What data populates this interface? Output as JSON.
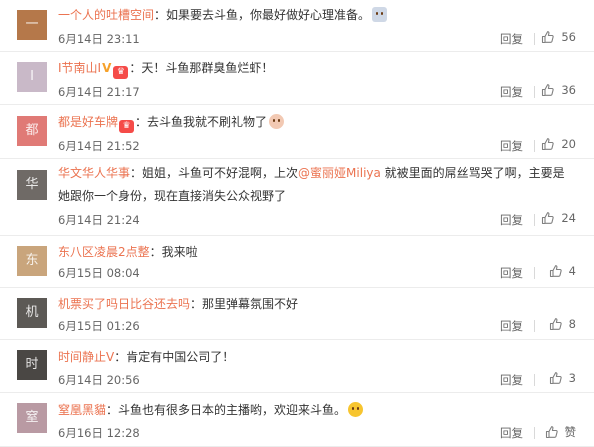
{
  "ui": {
    "reply_label": "回复"
  },
  "comments": [
    {
      "username": "一个人的吐槽空间",
      "text": "如果要去斗鱼，你最好做好心理准备。",
      "emoji": "person-emoji",
      "time": "6月14日 23:11",
      "likes": "56",
      "avatar_color": "#b5784a",
      "avatar_initial": "一"
    },
    {
      "username": "I节南山I",
      "badges": [
        "verified-v",
        "vip"
      ],
      "text": "天！斗鱼那群臭鱼烂虾！",
      "time": "6月14日 21:17",
      "likes": "36",
      "avatar_color": "#c9b9c8",
      "avatar_initial": "I"
    },
    {
      "username": "都是好车牌",
      "badges": [
        "vip"
      ],
      "text": "去斗鱼我就不刷礼物了",
      "emoji": "rabbit-emoji",
      "time": "6月14日 21:52",
      "likes": "20",
      "avatar_color": "#e07a76",
      "avatar_initial": "都"
    },
    {
      "username": "华文华人华事",
      "text_before": "姐姐，斗鱼可不好混啊，上次",
      "mention": "@蜜丽娅Miliya",
      "text_after": " 就被里面的屌丝骂哭了啊，主要是她跟你一个身份，现在直接消失公众视野了",
      "time": "6月14日 21:24",
      "likes": "24",
      "avatar_color": "#6f6a66",
      "avatar_initial": "华"
    },
    {
      "username": "东八区凌晨2点整",
      "text": "我来啦",
      "time": "6月15日 08:04",
      "likes": "4",
      "avatar_color": "#c9a57c",
      "avatar_initial": "东"
    },
    {
      "username": "机票买了吗日比谷还去吗",
      "text": "那里弹幕氛围不好",
      "time": "6月15日 01:26",
      "likes": "8",
      "avatar_color": "#5c5955",
      "avatar_initial": "机"
    },
    {
      "username": "时间静止V",
      "text": "肯定有中国公司了！",
      "time": "6月14日 20:56",
      "likes": "3",
      "avatar_color": "#4a4744",
      "avatar_initial": "时"
    },
    {
      "username": "窒凰黑貓",
      "text": "斗鱼也有很多日本的主播哟，欢迎来斗鱼。",
      "emoji": "smile-emoji",
      "time": "6月16日 12:28",
      "likes": "赞",
      "avatar_color": "#b99aa3",
      "avatar_initial": "窒"
    }
  ],
  "colors": {
    "username": "#eb7350",
    "text": "#333333",
    "meta": "#666666"
  }
}
